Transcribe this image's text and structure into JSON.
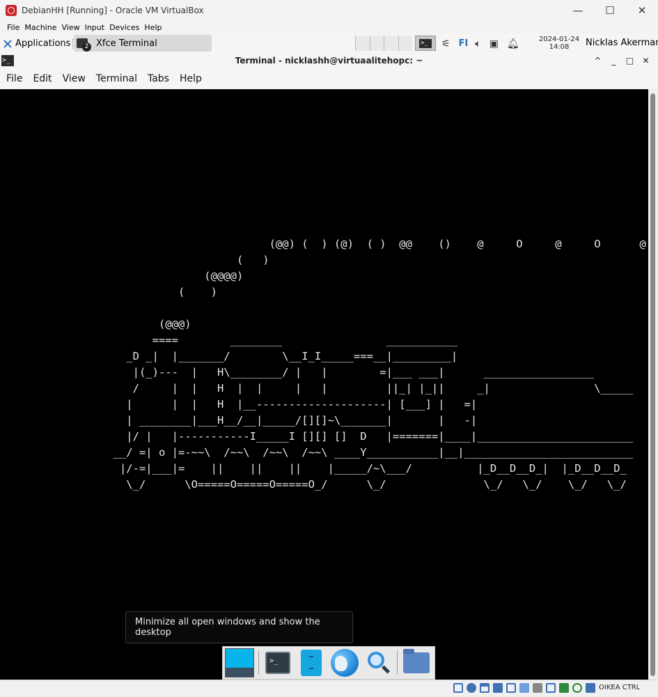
{
  "host": {
    "title": "DebianHH [Running] - Oracle VM VirtualBox",
    "controls": {
      "minimize": "—",
      "maximize": "☐",
      "close": "✕"
    },
    "menu": [
      "File",
      "Machine",
      "View",
      "Input",
      "Devices",
      "Help"
    ],
    "statusbar": {
      "host_key": "OIKEA CTRL"
    }
  },
  "panel": {
    "applications_label": "Applications",
    "task": {
      "label": "Xfce Terminal",
      "badge": "2"
    },
    "keyboard_layout": "FI",
    "clock": {
      "date": "2024-01-24",
      "time": "14:08"
    },
    "user": "Nicklas Akerman",
    "launcher_glyph": ">_"
  },
  "terminal": {
    "title": "Terminal - nicklashh@virtuaalitehopc: ~",
    "icon_glyph": ">_",
    "controls": {
      "shade": "^",
      "minimize": "_",
      "maximize": "□",
      "close": "✕"
    },
    "menu": [
      "File",
      "Edit",
      "View",
      "Terminal",
      "Tabs",
      "Help"
    ],
    "ascii_art": "                                                                                    \n                                                                                    \n                                         (@@) (  ) (@)  ( )  @@    ()    @     O     @     O      @\n                                    (   )\n                               (@@@@)\n                           (    )\n\n                        (@@@)\n                       ====        ________                ___________\n                   _D _|  |_______/        \\__I_I_____===__|_________|\n                    |(_)---  |   H\\________/ |   |        =|___ ___|      _________________\n                    /     |  |   H  |  |     |   |         ||_| |_||     _|                \\_____\n                   |      |  |   H  |__--------------------| [___] |   =|\n                   | ________|___H__/__|_____/[][]~\\_______|       |   -|\n                   |/ |   |-----------I_____I [][] []  D   |=======|____|________________________\n                 __/ =| o |=-~~\\  /~~\\  /~~\\  /~~\\ ____Y___________|__|__________________________\n                  |/-=|___|=    ||    ||    ||    |_____/~\\___/          |_D__D__D_|  |_D__D__D_\n                   \\_/      \\O=====O=====O=====O_/      \\_/               \\_/   \\_/    \\_/   \\_/"
  },
  "tooltip": {
    "text": "Minimize all open windows and show the desktop"
  },
  "dock": {
    "items": [
      "show-desktop",
      "terminal",
      "file-cabinet",
      "web-browser",
      "app-finder",
      "file-manager"
    ],
    "terminal_glyph": ">_"
  }
}
